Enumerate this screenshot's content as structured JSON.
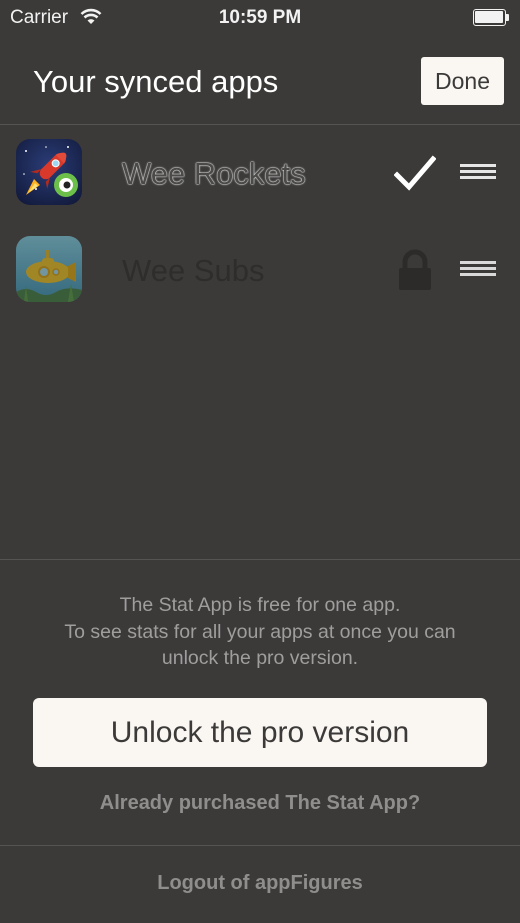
{
  "status_bar": {
    "carrier": "Carrier",
    "time": "10:59 PM",
    "wifi_icon": "wifi-icon",
    "battery_icon": "battery-icon",
    "battery_level": 1.0
  },
  "header": {
    "title": "Your synced apps",
    "done_label": "Done"
  },
  "apps": [
    {
      "name": "Wee Rockets",
      "icon": "rocket-app-icon",
      "status_icon": "checkmark-icon",
      "handle_icon": "reorder-handle-icon"
    },
    {
      "name": "Wee Subs",
      "icon": "submarine-app-icon",
      "status_icon": "lock-icon",
      "handle_icon": "reorder-handle-icon"
    }
  ],
  "footer": {
    "promo_lines": [
      "The Stat App is free for one app.",
      "To see stats for all your apps at once you can",
      "unlock the pro version."
    ],
    "unlock_label": "Unlock the pro version",
    "purchased_label": "Already purchased The Stat App?",
    "logout_label": "Logout of appFigures"
  },
  "colors": {
    "background": "#3b3a39",
    "button_bg": "#faf7f3",
    "muted_text": "#9f9e9d",
    "divider": "#555453"
  }
}
